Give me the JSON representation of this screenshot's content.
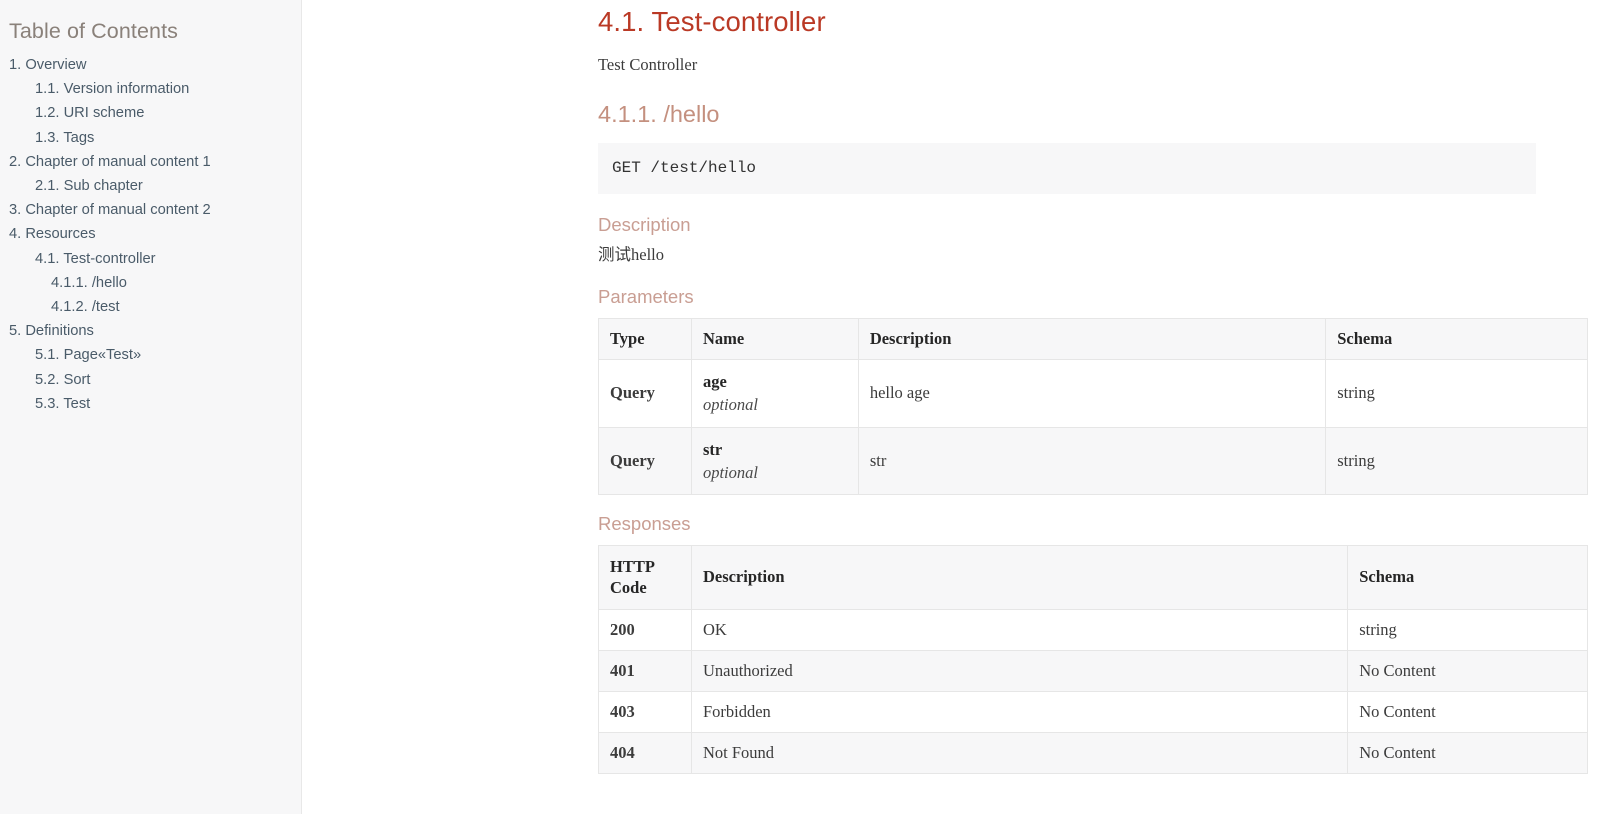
{
  "sidebar": {
    "title": "Table of Contents",
    "items": [
      {
        "label": "1. Overview",
        "level": 1
      },
      {
        "label": "1.1. Version information",
        "level": 2
      },
      {
        "label": "1.2. URI scheme",
        "level": 2
      },
      {
        "label": "1.3. Tags",
        "level": 2
      },
      {
        "label": "2. Chapter of manual content 1",
        "level": 1
      },
      {
        "label": "2.1. Sub chapter",
        "level": 2
      },
      {
        "label": "3. Chapter of manual content 2",
        "level": 1
      },
      {
        "label": "4. Resources",
        "level": 1
      },
      {
        "label": "4.1. Test-controller",
        "level": 2
      },
      {
        "label": "4.1.1. /hello",
        "level": 3
      },
      {
        "label": "4.1.2. /test",
        "level": 3
      },
      {
        "label": "5. Definitions",
        "level": 1
      },
      {
        "label": "5.1. Page«Test»",
        "level": 2
      },
      {
        "label": "5.2. Sort",
        "level": 2
      },
      {
        "label": "5.3. Test",
        "level": 2
      }
    ]
  },
  "main": {
    "section_title": "4.1. Test-controller",
    "section_description": "Test Controller",
    "operation_title": "4.1.1. /hello",
    "operation_code": "GET /test/hello",
    "description_heading": "Description",
    "description_text": "测试hello",
    "parameters_heading": "Parameters",
    "parameters_table": {
      "headers": [
        "Type",
        "Name",
        "Description",
        "Schema"
      ],
      "rows": [
        {
          "type": "Query",
          "name": "age",
          "required": "optional",
          "description": "hello age",
          "schema": "string"
        },
        {
          "type": "Query",
          "name": "str",
          "required": "optional",
          "description": "str",
          "schema": "string"
        }
      ]
    },
    "responses_heading": "Responses",
    "responses_table": {
      "headers": [
        "HTTP Code",
        "Description",
        "Schema"
      ],
      "rows": [
        {
          "code": "200",
          "description": "OK",
          "schema": "string"
        },
        {
          "code": "401",
          "description": "Unauthorized",
          "schema": "No Content"
        },
        {
          "code": "403",
          "description": "Forbidden",
          "schema": "No Content"
        },
        {
          "code": "404",
          "description": "Not Found",
          "schema": "No Content"
        }
      ]
    }
  },
  "colors": {
    "sidebar_bg": "#f7f7f8",
    "sidebar_link": "#4a5b69",
    "sidebar_title": "#8a817a",
    "h2_accent": "#ba3925",
    "h3_accent": "#c4907f",
    "block_title_accent": "#c99e93",
    "table_border": "#e6e6e6",
    "stripe_bg": "#f7f7f8"
  }
}
